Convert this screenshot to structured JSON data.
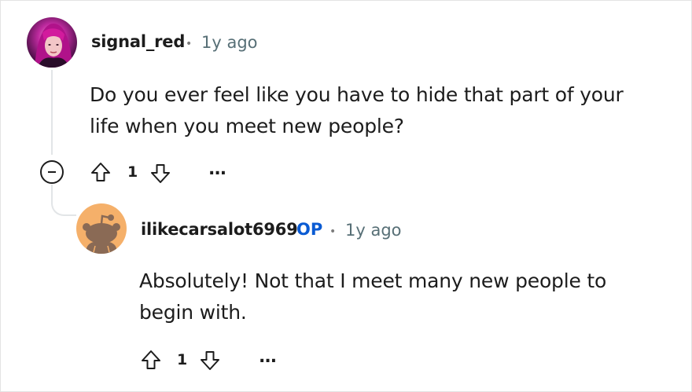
{
  "comments": [
    {
      "username": "signal_red",
      "separator": "•",
      "timestamp": "1y ago",
      "body_lines": [
        "Do you ever feel like you have to hide that part of your",
        "life when you meet new people?"
      ],
      "vote_count": "1",
      "more_label": "...",
      "avatar": "user-avatar-photo"
    },
    {
      "username": "ilikecarsalot6969",
      "op_badge": "OP",
      "separator": "•",
      "timestamp": "1y ago",
      "body_lines": [
        "Absolutely! Not that I meet many new people to",
        "begin with."
      ],
      "vote_count": "1",
      "more_label": "...",
      "avatar": "default-snoo-avatar"
    }
  ],
  "colors": {
    "op_badge": "#0a5bd3",
    "avatar_2_bg": "#f5b06a",
    "thread_line": "#e2e5e7",
    "timestamp": "#576f76"
  }
}
